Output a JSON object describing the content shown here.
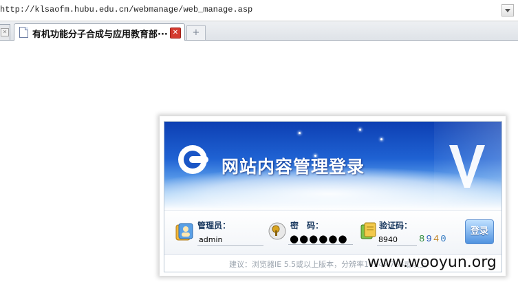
{
  "address_bar": {
    "url": "http://klsaofm.hubu.edu.cn/webmanage/web_manage.asp"
  },
  "tabs": [
    {
      "title": "有机功能分子合成与应用教育部···",
      "active": true
    }
  ],
  "banner": {
    "title": "网站内容管理登录"
  },
  "form": {
    "username": {
      "label": "管理员：",
      "value": "admin"
    },
    "password": {
      "label": "密　码：",
      "value": "●●●●●●"
    },
    "captcha": {
      "label": "验证码：",
      "value": "8940",
      "image_digits": [
        "8",
        "9",
        "4",
        "0"
      ]
    },
    "submit_label": "登录"
  },
  "footer_tip": "建议：浏览器IE 5.5或以上版本，分辨率1024×768或以上",
  "watermark": "www.wooyun.org",
  "colors": {
    "banner_top": "#0d3fb2",
    "label": "#17365d",
    "button": "#4f92e0",
    "tab_close": "#d43a2f"
  },
  "icons": [
    "dropdown-arrow-icon",
    "page-icon",
    "close-icon",
    "new-tab-icon",
    "site-logo-icon",
    "v-logo-icon",
    "user-icon",
    "lock-icon",
    "key-icon"
  ]
}
